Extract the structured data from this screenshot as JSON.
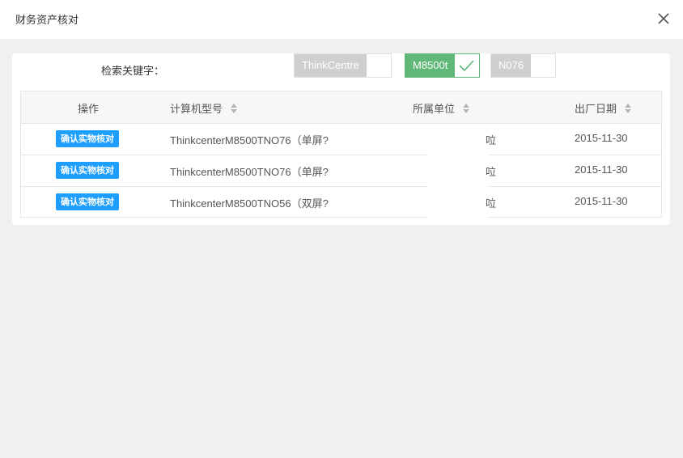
{
  "window": {
    "title": "财务资产核对"
  },
  "search": {
    "label": "检索关键字：",
    "keywords": [
      {
        "text": "ThinkCentre",
        "checked": false
      },
      {
        "text": "M8500t",
        "checked": true
      },
      {
        "text": "N076",
        "checked": false
      }
    ]
  },
  "table": {
    "columns": [
      "操作",
      "计算机型号",
      "所属单位",
      "出厂日期"
    ],
    "rows": [
      {
        "action": "确认实物核对",
        "model": "ThinkcenterM8500TNO76（单屏?",
        "unit": "㕸",
        "date": "2015-11-30"
      },
      {
        "action": "确认实物核对",
        "model": "ThinkcenterM8500TNO76（单屏?",
        "unit": "㕸",
        "date": "2015-11-30"
      },
      {
        "action": "确认实物核对",
        "model": "ThinkcenterM8500TNO56（双屏?",
        "unit": "㕸",
        "date": "2015-11-30"
      }
    ]
  },
  "colors": {
    "accent_blue": "#1e9fff",
    "checked_green": "#5fb878",
    "unchecked_gray": "#cfcfcf"
  },
  "icons": {
    "close": "close-icon",
    "check": "check-icon",
    "sort": "sort-icon"
  }
}
